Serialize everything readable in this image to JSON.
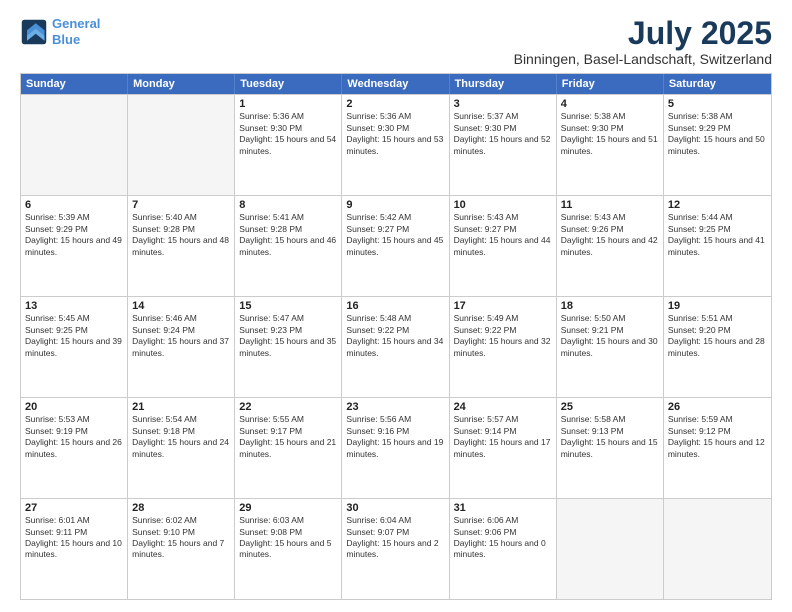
{
  "header": {
    "logo_line1": "General",
    "logo_line2": "Blue",
    "title": "July 2025",
    "subtitle": "Binningen, Basel-Landschaft, Switzerland"
  },
  "calendar": {
    "days_of_week": [
      "Sunday",
      "Monday",
      "Tuesday",
      "Wednesday",
      "Thursday",
      "Friday",
      "Saturday"
    ],
    "rows": [
      [
        {
          "day": "",
          "empty": true
        },
        {
          "day": "",
          "empty": true
        },
        {
          "day": "1",
          "sunrise": "Sunrise: 5:36 AM",
          "sunset": "Sunset: 9:30 PM",
          "daylight": "Daylight: 15 hours and 54 minutes."
        },
        {
          "day": "2",
          "sunrise": "Sunrise: 5:36 AM",
          "sunset": "Sunset: 9:30 PM",
          "daylight": "Daylight: 15 hours and 53 minutes."
        },
        {
          "day": "3",
          "sunrise": "Sunrise: 5:37 AM",
          "sunset": "Sunset: 9:30 PM",
          "daylight": "Daylight: 15 hours and 52 minutes."
        },
        {
          "day": "4",
          "sunrise": "Sunrise: 5:38 AM",
          "sunset": "Sunset: 9:30 PM",
          "daylight": "Daylight: 15 hours and 51 minutes."
        },
        {
          "day": "5",
          "sunrise": "Sunrise: 5:38 AM",
          "sunset": "Sunset: 9:29 PM",
          "daylight": "Daylight: 15 hours and 50 minutes."
        }
      ],
      [
        {
          "day": "6",
          "sunrise": "Sunrise: 5:39 AM",
          "sunset": "Sunset: 9:29 PM",
          "daylight": "Daylight: 15 hours and 49 minutes."
        },
        {
          "day": "7",
          "sunrise": "Sunrise: 5:40 AM",
          "sunset": "Sunset: 9:28 PM",
          "daylight": "Daylight: 15 hours and 48 minutes."
        },
        {
          "day": "8",
          "sunrise": "Sunrise: 5:41 AM",
          "sunset": "Sunset: 9:28 PM",
          "daylight": "Daylight: 15 hours and 46 minutes."
        },
        {
          "day": "9",
          "sunrise": "Sunrise: 5:42 AM",
          "sunset": "Sunset: 9:27 PM",
          "daylight": "Daylight: 15 hours and 45 minutes."
        },
        {
          "day": "10",
          "sunrise": "Sunrise: 5:43 AM",
          "sunset": "Sunset: 9:27 PM",
          "daylight": "Daylight: 15 hours and 44 minutes."
        },
        {
          "day": "11",
          "sunrise": "Sunrise: 5:43 AM",
          "sunset": "Sunset: 9:26 PM",
          "daylight": "Daylight: 15 hours and 42 minutes."
        },
        {
          "day": "12",
          "sunrise": "Sunrise: 5:44 AM",
          "sunset": "Sunset: 9:25 PM",
          "daylight": "Daylight: 15 hours and 41 minutes."
        }
      ],
      [
        {
          "day": "13",
          "sunrise": "Sunrise: 5:45 AM",
          "sunset": "Sunset: 9:25 PM",
          "daylight": "Daylight: 15 hours and 39 minutes."
        },
        {
          "day": "14",
          "sunrise": "Sunrise: 5:46 AM",
          "sunset": "Sunset: 9:24 PM",
          "daylight": "Daylight: 15 hours and 37 minutes."
        },
        {
          "day": "15",
          "sunrise": "Sunrise: 5:47 AM",
          "sunset": "Sunset: 9:23 PM",
          "daylight": "Daylight: 15 hours and 35 minutes."
        },
        {
          "day": "16",
          "sunrise": "Sunrise: 5:48 AM",
          "sunset": "Sunset: 9:22 PM",
          "daylight": "Daylight: 15 hours and 34 minutes."
        },
        {
          "day": "17",
          "sunrise": "Sunrise: 5:49 AM",
          "sunset": "Sunset: 9:22 PM",
          "daylight": "Daylight: 15 hours and 32 minutes."
        },
        {
          "day": "18",
          "sunrise": "Sunrise: 5:50 AM",
          "sunset": "Sunset: 9:21 PM",
          "daylight": "Daylight: 15 hours and 30 minutes."
        },
        {
          "day": "19",
          "sunrise": "Sunrise: 5:51 AM",
          "sunset": "Sunset: 9:20 PM",
          "daylight": "Daylight: 15 hours and 28 minutes."
        }
      ],
      [
        {
          "day": "20",
          "sunrise": "Sunrise: 5:53 AM",
          "sunset": "Sunset: 9:19 PM",
          "daylight": "Daylight: 15 hours and 26 minutes."
        },
        {
          "day": "21",
          "sunrise": "Sunrise: 5:54 AM",
          "sunset": "Sunset: 9:18 PM",
          "daylight": "Daylight: 15 hours and 24 minutes."
        },
        {
          "day": "22",
          "sunrise": "Sunrise: 5:55 AM",
          "sunset": "Sunset: 9:17 PM",
          "daylight": "Daylight: 15 hours and 21 minutes."
        },
        {
          "day": "23",
          "sunrise": "Sunrise: 5:56 AM",
          "sunset": "Sunset: 9:16 PM",
          "daylight": "Daylight: 15 hours and 19 minutes."
        },
        {
          "day": "24",
          "sunrise": "Sunrise: 5:57 AM",
          "sunset": "Sunset: 9:14 PM",
          "daylight": "Daylight: 15 hours and 17 minutes."
        },
        {
          "day": "25",
          "sunrise": "Sunrise: 5:58 AM",
          "sunset": "Sunset: 9:13 PM",
          "daylight": "Daylight: 15 hours and 15 minutes."
        },
        {
          "day": "26",
          "sunrise": "Sunrise: 5:59 AM",
          "sunset": "Sunset: 9:12 PM",
          "daylight": "Daylight: 15 hours and 12 minutes."
        }
      ],
      [
        {
          "day": "27",
          "sunrise": "Sunrise: 6:01 AM",
          "sunset": "Sunset: 9:11 PM",
          "daylight": "Daylight: 15 hours and 10 minutes."
        },
        {
          "day": "28",
          "sunrise": "Sunrise: 6:02 AM",
          "sunset": "Sunset: 9:10 PM",
          "daylight": "Daylight: 15 hours and 7 minutes."
        },
        {
          "day": "29",
          "sunrise": "Sunrise: 6:03 AM",
          "sunset": "Sunset: 9:08 PM",
          "daylight": "Daylight: 15 hours and 5 minutes."
        },
        {
          "day": "30",
          "sunrise": "Sunrise: 6:04 AM",
          "sunset": "Sunset: 9:07 PM",
          "daylight": "Daylight: 15 hours and 2 minutes."
        },
        {
          "day": "31",
          "sunrise": "Sunrise: 6:06 AM",
          "sunset": "Sunset: 9:06 PM",
          "daylight": "Daylight: 15 hours and 0 minutes."
        },
        {
          "day": "",
          "empty": true
        },
        {
          "day": "",
          "empty": true
        }
      ]
    ]
  }
}
